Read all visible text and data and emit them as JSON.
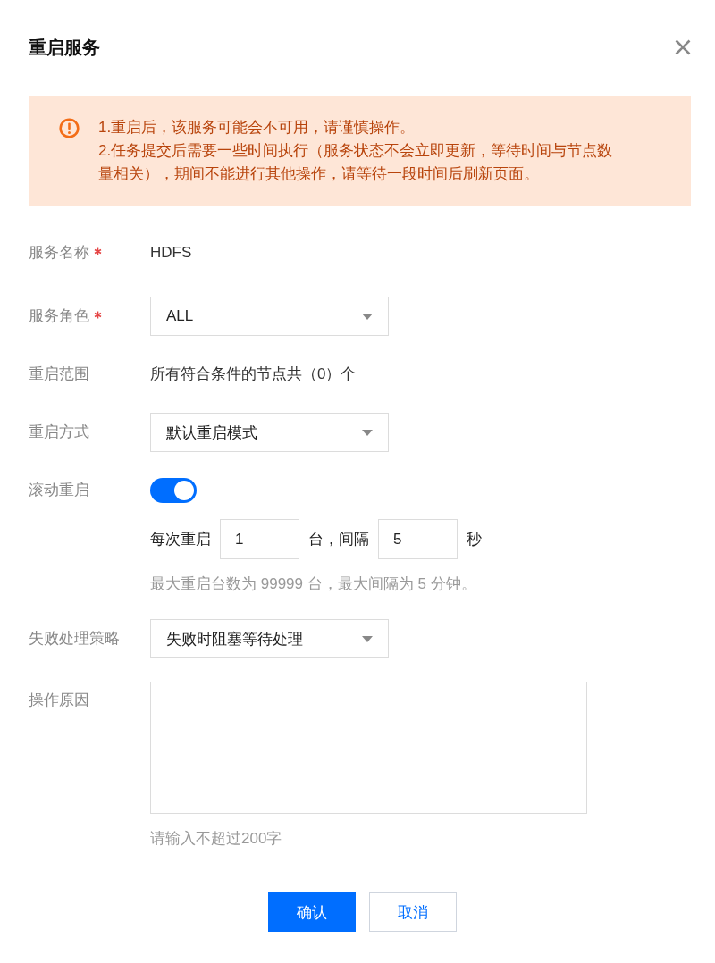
{
  "dialog": {
    "title": "重启服务"
  },
  "alert": {
    "lines": [
      "1.重启后，该服务可能会不可用，请谨慎操作。",
      "2.任务提交后需要一些时间执行（服务状态不会立即更新，等待时间与节点数量相关），期间不能进行其他操作，请等待一段时间后刷新页面。"
    ]
  },
  "form": {
    "fields": [
      {
        "kind": "text",
        "label": "服务名称",
        "required": true,
        "value": "HDFS"
      },
      {
        "kind": "select",
        "label": "服务角色",
        "required": true,
        "value": "ALL"
      },
      {
        "kind": "text",
        "label": "重启范围",
        "required": false,
        "value": "所有符合条件的节点共（0）个"
      },
      {
        "kind": "select",
        "label": "重启方式",
        "required": false,
        "value": "默认重启模式"
      },
      {
        "kind": "toggle",
        "label": "滚动重启",
        "required": false,
        "on": true,
        "rolling": {
          "parts": [
            {
              "kind": "text",
              "text": "每次重启"
            },
            {
              "kind": "input",
              "value": "1"
            },
            {
              "kind": "text",
              "text": "台，间隔"
            },
            {
              "kind": "input",
              "value": "5"
            },
            {
              "kind": "text",
              "text": "秒"
            }
          ],
          "hint": "最大重启台数为 99999 台，最大间隔为 5 分钟。"
        }
      },
      {
        "kind": "select",
        "label": "失败处理策略",
        "required": false,
        "value": "失败时阻塞等待处理"
      },
      {
        "kind": "textarea",
        "label": "操作原因",
        "required": false,
        "hint": "请输入不超过200字"
      }
    ]
  },
  "buttons": [
    {
      "label": "确认",
      "kind": "primary"
    },
    {
      "label": "取消",
      "kind": "secondary"
    }
  ]
}
